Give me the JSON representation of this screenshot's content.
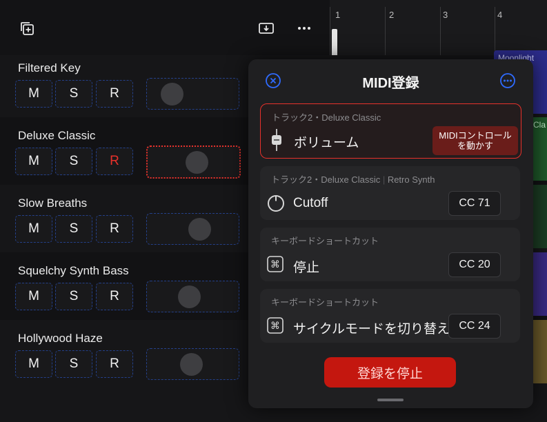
{
  "ruler": {
    "bars": [
      "1",
      "2",
      "3",
      "4"
    ]
  },
  "tracks": [
    {
      "name": "Filtered Key",
      "mute": "M",
      "solo": "S",
      "record": "R",
      "record_armed": false,
      "level": 0.2,
      "learning": false
    },
    {
      "name": "Deluxe Classic",
      "mute": "M",
      "solo": "S",
      "record": "R",
      "record_armed": true,
      "level": 0.55,
      "learning": true
    },
    {
      "name": "Slow Breaths",
      "mute": "M",
      "solo": "S",
      "record": "R",
      "record_armed": false,
      "level": 0.6,
      "learning": false
    },
    {
      "name": "Squelchy Synth Bass",
      "mute": "M",
      "solo": "S",
      "record": "R",
      "record_armed": false,
      "level": 0.45,
      "learning": false
    },
    {
      "name": "Hollywood Haze",
      "mute": "M",
      "solo": "S",
      "record": "R",
      "record_armed": false,
      "level": 0.48,
      "learning": false
    }
  ],
  "regions": {
    "moonlight_label": "Moonlight",
    "cla_label": "Cla"
  },
  "panel": {
    "title": "MIDI登録",
    "assignments": [
      {
        "source": "トラック2・Deluxe Classic",
        "source_extra": "",
        "label": "ボリューム",
        "icon": "fader-icon",
        "value": "MIDIコントロール\nを動かす",
        "active": true
      },
      {
        "source": "トラック2・Deluxe Classic",
        "source_extra": "Retro Synth",
        "label": "Cutoff",
        "icon": "knob-icon",
        "value": "CC 71",
        "active": false
      },
      {
        "source": "キーボードショートカット",
        "source_extra": "",
        "label": "停止",
        "icon": "command-key-icon",
        "value": "CC 20",
        "active": false
      },
      {
        "source": "キーボードショートカット",
        "source_extra": "",
        "label": "サイクルモードを切り替え",
        "icon": "command-key-icon",
        "value": "CC 24",
        "active": false
      }
    ],
    "stop_button": "登録を停止"
  },
  "colors": {
    "accent_blue": "#2f6bff",
    "record_red": "#e8312b",
    "stop_red": "#c4170f"
  }
}
